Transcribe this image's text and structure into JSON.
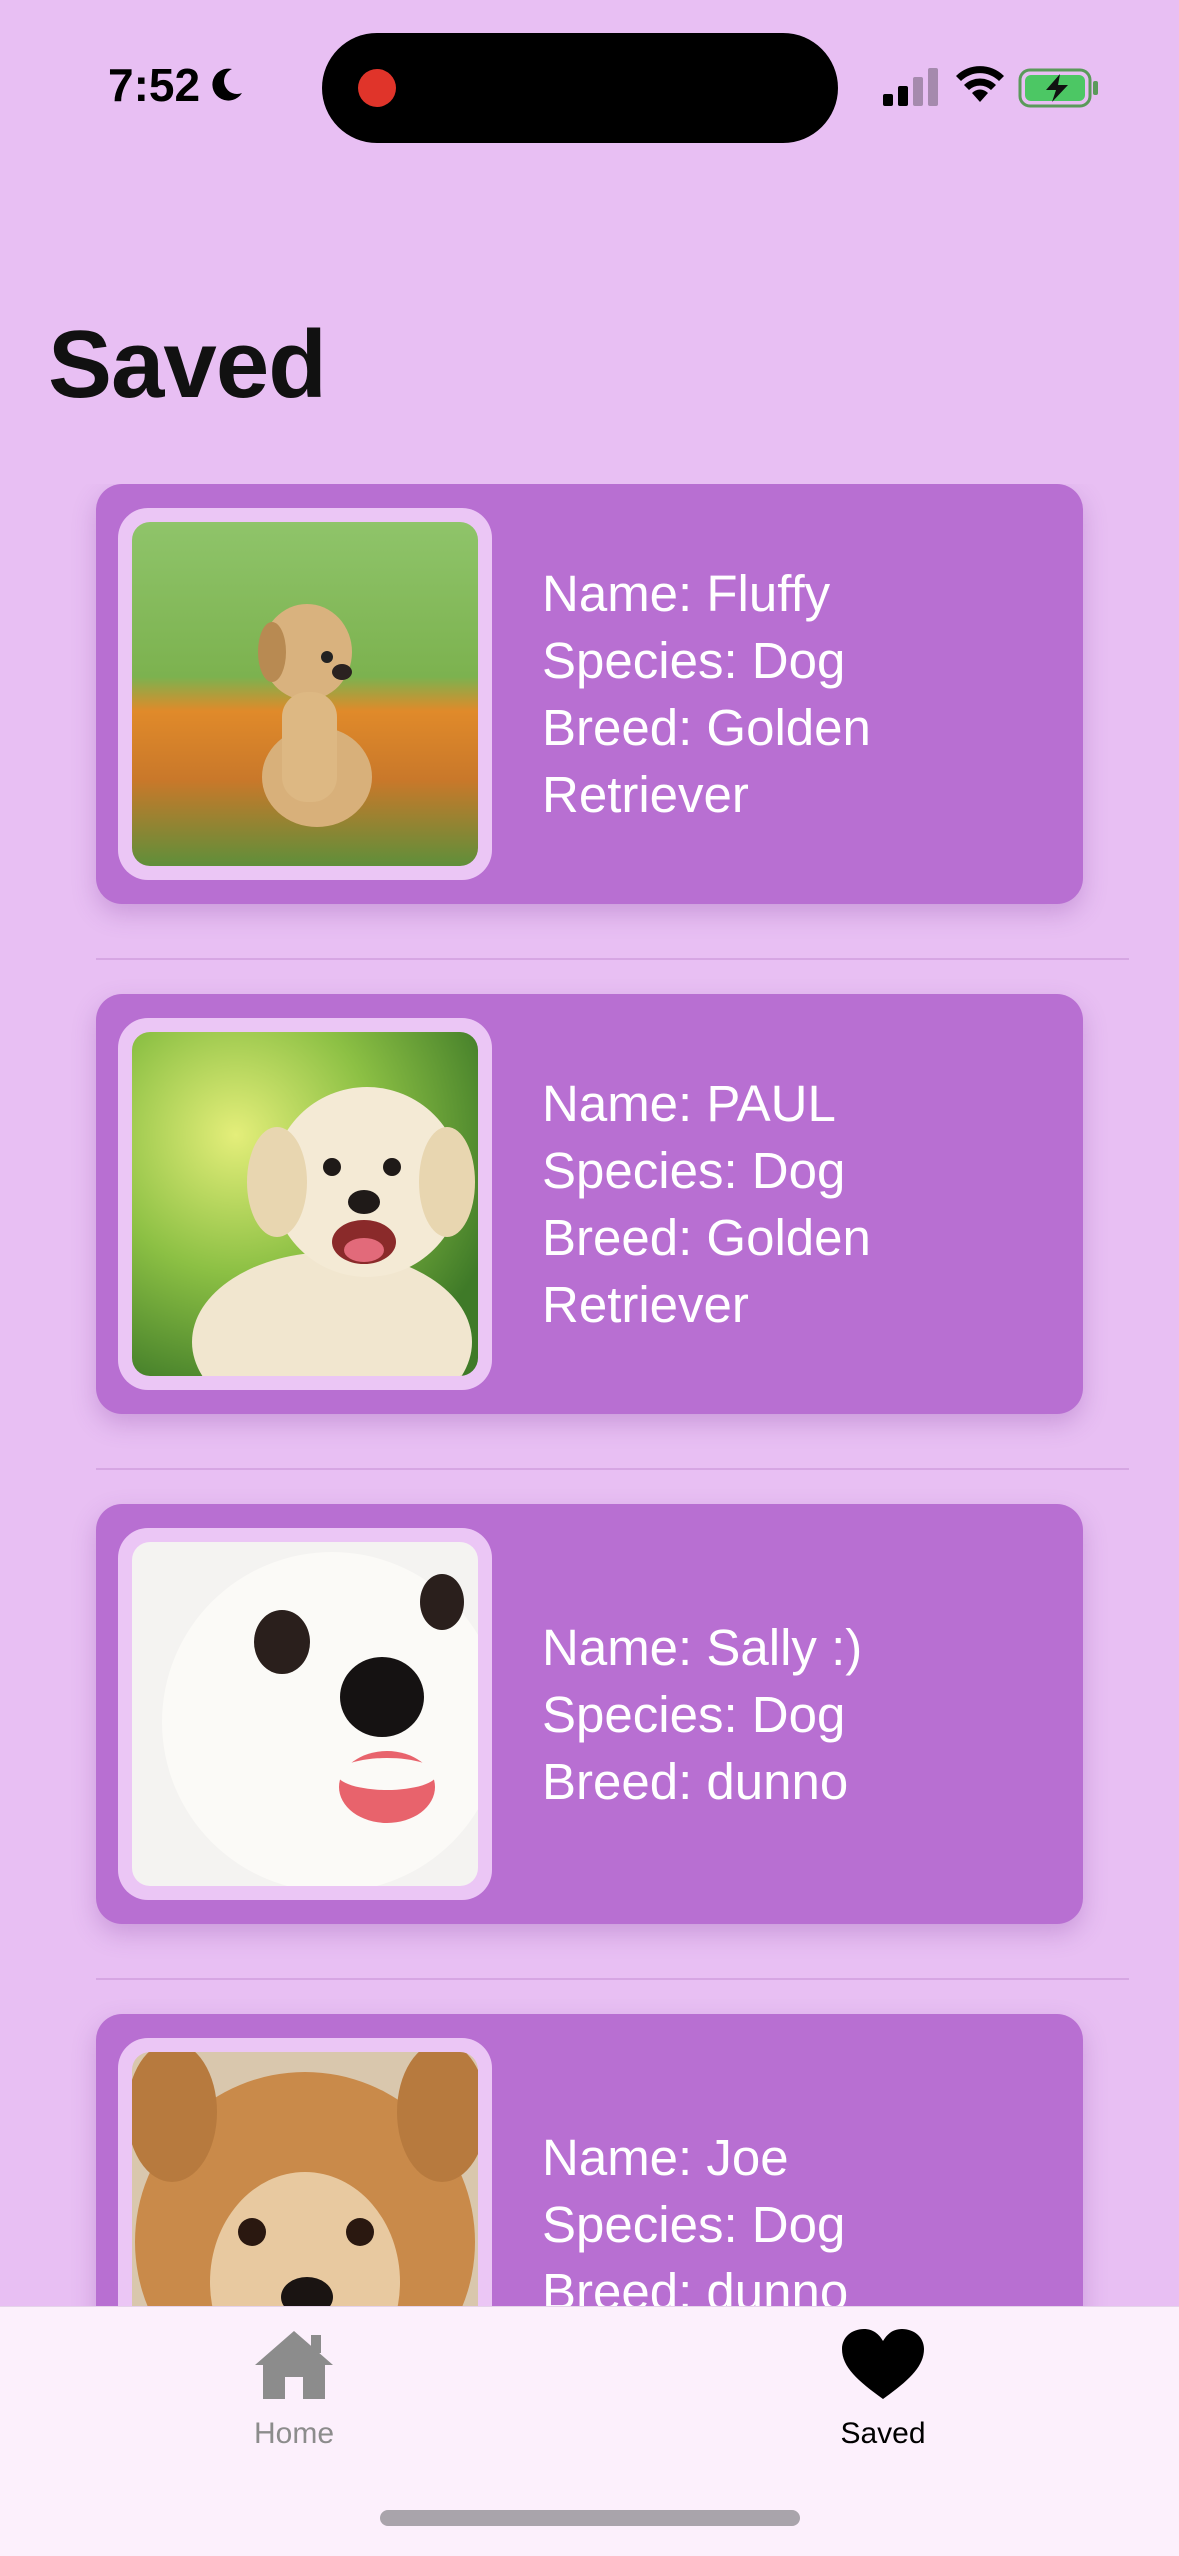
{
  "status_bar": {
    "time": "7:52",
    "icons": [
      "moon-icon",
      "recording-dot",
      "signal-icon",
      "wifi-icon",
      "battery-charging-icon"
    ]
  },
  "page_title": "Saved",
  "pets": [
    {
      "name_line": "Name: Fluffy",
      "species_line": "Species: Dog",
      "breed_line": "Breed: Golden Retriever",
      "photo": "golden-puppy-in-flower-field"
    },
    {
      "name_line": "Name: PAUL",
      "species_line": "Species: Dog",
      "breed_line": "Breed: Golden Retriever",
      "photo": "labrador-puppy-smiling"
    },
    {
      "name_line": "Name: Sally :)",
      "species_line": "Species: Dog",
      "breed_line": "Breed: dunno",
      "photo": "white-fluffy-puppy-closeup"
    },
    {
      "name_line": "Name: Joe",
      "species_line": "Species: Dog",
      "breed_line": "Breed: dunno",
      "photo": "yorkshire-terrier-face"
    }
  ],
  "tab_bar": {
    "home_label": "Home",
    "saved_label": "Saved",
    "active": "Saved"
  },
  "colors": {
    "background": "#e8bff3",
    "card": "#b86fd2",
    "photo_frame": "#ebc6f5",
    "tab_bar": "#fcf0fc"
  }
}
